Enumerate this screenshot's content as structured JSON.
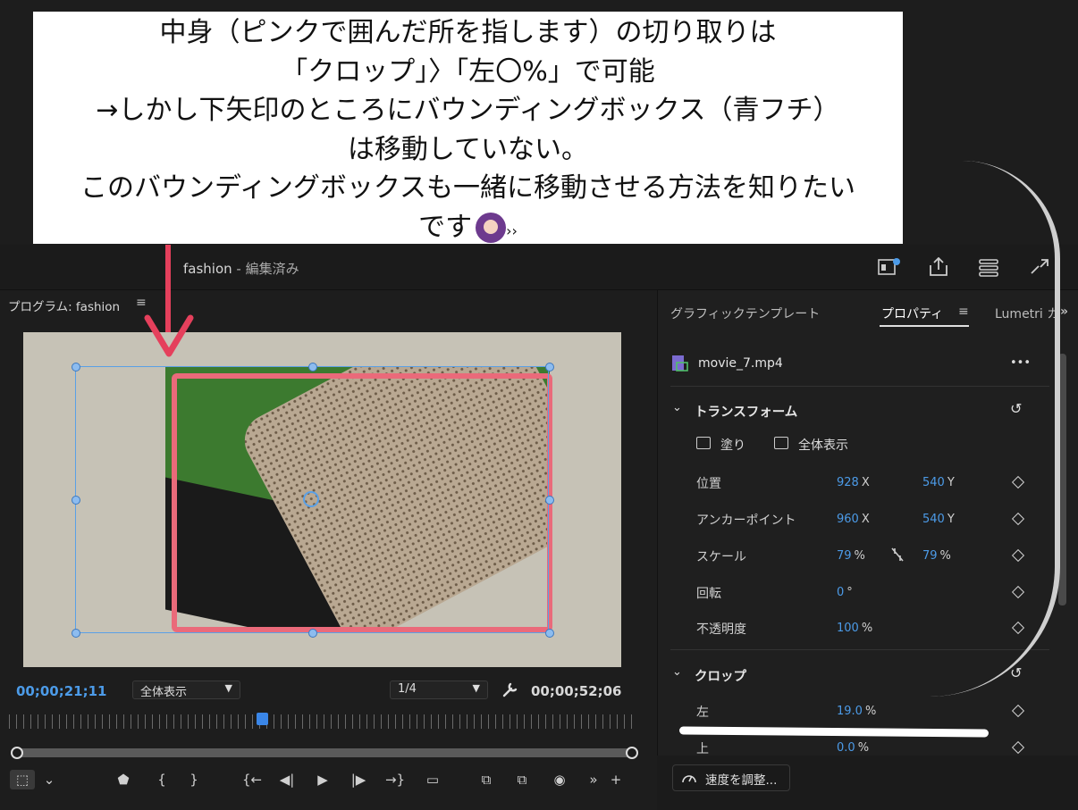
{
  "callout": {
    "lines": [
      "中身（ピンクで囲んだ所を指します）の切り取りは",
      "「クロップ」〉「左〇%」で可能",
      "→しかし下矢印のところにバウンディングボックス（青フチ）",
      "は移動していない。",
      "このバウンディングボックスも一緒に移動させる方法を知りたい",
      "です"
    ],
    "trailing_mark": "››"
  },
  "header": {
    "project": "fashion",
    "status": " - 編集済み"
  },
  "program_panel": {
    "title": "プログラム: fashion",
    "menu_icon": "hamburger-icon",
    "timecode_current": "00;00;21;11",
    "zoom_select": "全体表示",
    "resolution_select": "1/4",
    "timecode_duration": "00;00;52;06"
  },
  "tabs": {
    "graphics": "グラフィックテンプレート",
    "properties": "プロパティ",
    "lumetri": "Lumetri カ"
  },
  "clip": {
    "name": "movie_7.mp4",
    "more": "•••"
  },
  "transform": {
    "title": "トランスフォーム",
    "fill_label": "塗り",
    "fit_label": "全体表示",
    "rows": {
      "position": {
        "label": "位置",
        "x": "928",
        "xu": "X",
        "y": "540",
        "yu": "Y"
      },
      "anchor": {
        "label": "アンカーポイント",
        "x": "960",
        "xu": "X",
        "y": "540",
        "yu": "Y"
      },
      "scale": {
        "label": "スケール",
        "x": "79",
        "xu": "%",
        "y": "79",
        "yu": "%"
      },
      "rotation": {
        "label": "回転",
        "x": "0",
        "xu": "°"
      },
      "opacity": {
        "label": "不透明度",
        "x": "100",
        "xu": "%"
      }
    }
  },
  "crop": {
    "title": "クロップ",
    "left": {
      "label": "左",
      "value": "19.0",
      "unit": "%"
    },
    "top": {
      "label": "上",
      "value": "0.0",
      "unit": "%"
    }
  },
  "speed_button": "速度を調整..."
}
